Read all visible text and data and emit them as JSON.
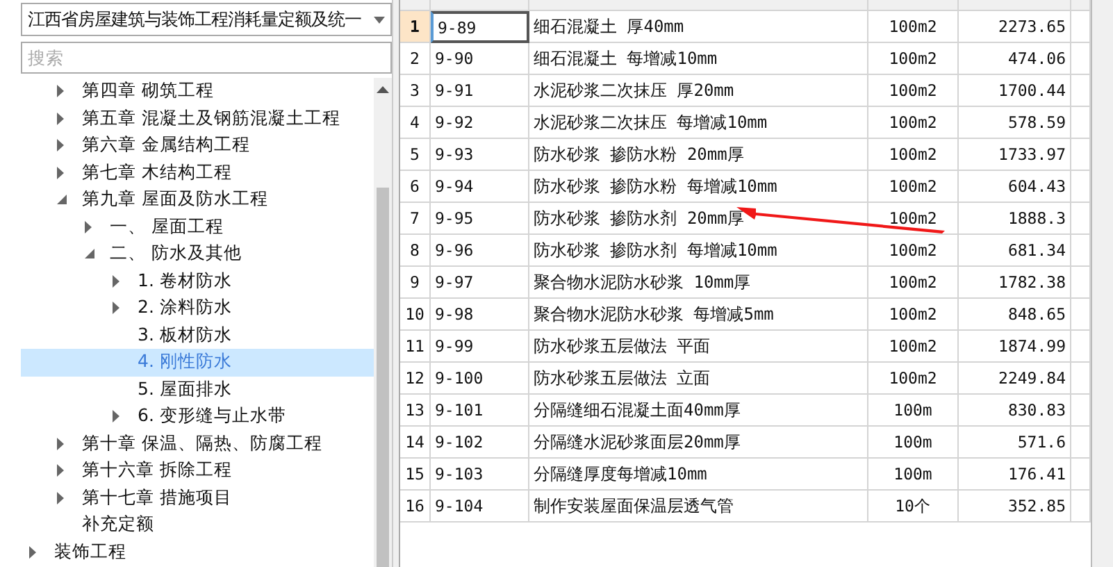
{
  "library_select": {
    "value": "江西省房屋建筑与装饰工程消耗量定额及统一"
  },
  "search": {
    "placeholder": "搜索"
  },
  "tree": [
    {
      "children": [
        {
          "label": "第四章 砌筑工程",
          "kind": "branch",
          "expanded": false,
          "selected": false
        },
        {
          "label": "第五章 混凝土及钢筋混凝土工程",
          "kind": "branch",
          "expanded": false,
          "selected": false
        },
        {
          "label": "第六章 金属结构工程",
          "kind": "branch",
          "expanded": false,
          "selected": false
        },
        {
          "label": "第七章 木结构工程",
          "kind": "branch",
          "expanded": false,
          "selected": false
        },
        {
          "label": "第九章 屋面及防水工程",
          "kind": "branch",
          "expanded": true,
          "selected": false,
          "children": [
            {
              "label": "一、 屋面工程",
              "kind": "branch",
              "expanded": false,
              "selected": false
            },
            {
              "label": "二、 防水及其他",
              "kind": "branch",
              "expanded": true,
              "selected": false,
              "children": [
                {
                  "label": "1. 卷材防水",
                  "kind": "branch",
                  "expanded": false,
                  "selected": false
                },
                {
                  "label": "2. 涂料防水",
                  "kind": "branch",
                  "expanded": false,
                  "selected": false
                },
                {
                  "label": "3. 板材防水",
                  "kind": "leaf",
                  "selected": false
                },
                {
                  "label": "4. 刚性防水",
                  "kind": "leaf",
                  "selected": true
                },
                {
                  "label": "5. 屋面排水",
                  "kind": "leaf",
                  "selected": false
                },
                {
                  "label": "6. 变形缝与止水带",
                  "kind": "branch",
                  "expanded": false,
                  "selected": false
                }
              ]
            }
          ]
        },
        {
          "label": "第十章 保温、隔热、防腐工程",
          "kind": "branch",
          "expanded": false,
          "selected": false
        },
        {
          "label": "第十六章 拆除工程",
          "kind": "branch",
          "expanded": false,
          "selected": false
        },
        {
          "label": "第十七章 措施项目",
          "kind": "branch",
          "expanded": false,
          "selected": false
        },
        {
          "label": "补充定额",
          "kind": "leaf",
          "selected": false
        }
      ]
    },
    {
      "label": "装饰工程",
      "kind": "branch",
      "expanded": false,
      "selected": false
    }
  ],
  "table": {
    "rows": [
      {
        "index": "1",
        "code": "9-89",
        "name": "细石混凝土 厚40mm",
        "unit": "100m2",
        "price": "2273.65",
        "selected": true
      },
      {
        "index": "2",
        "code": "9-90",
        "name": "细石混凝土 每增减10mm",
        "unit": "100m2",
        "price": "474.06",
        "selected": false
      },
      {
        "index": "3",
        "code": "9-91",
        "name": "水泥砂浆二次抹压 厚20mm",
        "unit": "100m2",
        "price": "1700.44",
        "selected": false
      },
      {
        "index": "4",
        "code": "9-92",
        "name": "水泥砂浆二次抹压 每增减10mm",
        "unit": "100m2",
        "price": "578.59",
        "selected": false
      },
      {
        "index": "5",
        "code": "9-93",
        "name": "防水砂浆 掺防水粉 20mm厚",
        "unit": "100m2",
        "price": "1733.97",
        "selected": false
      },
      {
        "index": "6",
        "code": "9-94",
        "name": "防水砂浆 掺防水粉 每增减10mm",
        "unit": "100m2",
        "price": "604.43",
        "selected": false
      },
      {
        "index": "7",
        "code": "9-95",
        "name": "防水砂浆 掺防水剂 20mm厚",
        "unit": "100m2",
        "price": "1888.3",
        "selected": false
      },
      {
        "index": "8",
        "code": "9-96",
        "name": "防水砂浆 掺防水剂 每增减10mm",
        "unit": "100m2",
        "price": "681.34",
        "selected": false
      },
      {
        "index": "9",
        "code": "9-97",
        "name": "聚合物水泥防水砂浆 10mm厚",
        "unit": "100m2",
        "price": "1782.38",
        "selected": false
      },
      {
        "index": "10",
        "code": "9-98",
        "name": "聚合物水泥防水砂浆 每增减5mm",
        "unit": "100m2",
        "price": "848.65",
        "selected": false
      },
      {
        "index": "11",
        "code": "9-99",
        "name": "防水砂浆五层做法 平面",
        "unit": "100m2",
        "price": "1874.99",
        "selected": false
      },
      {
        "index": "12",
        "code": "9-100",
        "name": "防水砂浆五层做法 立面",
        "unit": "100m2",
        "price": "2249.84",
        "selected": false
      },
      {
        "index": "13",
        "code": "9-101",
        "name": "分隔缝细石混凝土面40mm厚",
        "unit": "100m",
        "price": "830.83",
        "selected": false
      },
      {
        "index": "14",
        "code": "9-102",
        "name": "分隔缝水泥砂浆面层20mm厚",
        "unit": "100m",
        "price": "571.6",
        "selected": false
      },
      {
        "index": "15",
        "code": "9-103",
        "name": "分隔缝厚度每增减10mm",
        "unit": "100m",
        "price": "176.41",
        "selected": false
      },
      {
        "index": "16",
        "code": "9-104",
        "name": "制作安装屋面保温层透气管",
        "unit": "10个",
        "price": "352.85",
        "selected": false
      }
    ]
  }
}
